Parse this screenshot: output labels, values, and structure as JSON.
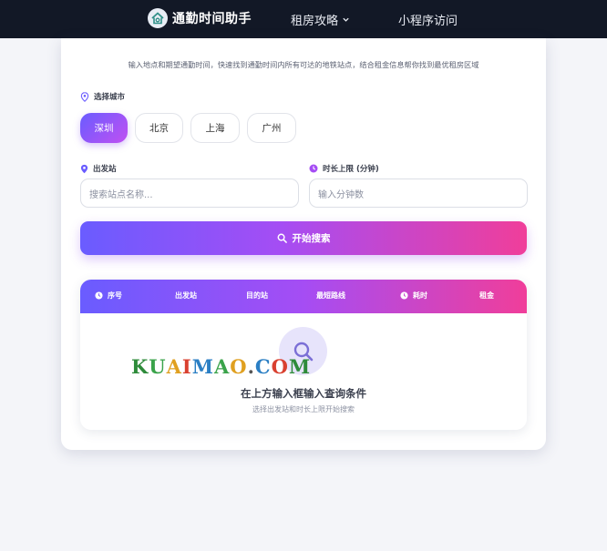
{
  "topbar": {
    "brand": "通勤时间助手",
    "nav": [
      {
        "label": "租房攻略"
      },
      {
        "label": "小程序访问"
      }
    ]
  },
  "intro": "输入地点和期望通勤时间，快速找到通勤时间内所有可达的地铁站点，结合租金信息帮你找到最优租房区域",
  "city": {
    "label": "选择城市",
    "options": [
      "深圳",
      "北京",
      "上海",
      "广州"
    ],
    "selected": "深圳"
  },
  "start": {
    "label": "出发站",
    "placeholder": "搜索站点名称..."
  },
  "duration": {
    "label": "时长上限 (分钟)",
    "placeholder": "输入分钟数"
  },
  "search_button": "开始搜索",
  "table": {
    "headers": [
      "序号",
      "出发站",
      "目的站",
      "最短路线",
      "耗时",
      "租金"
    ]
  },
  "empty": {
    "title": "在上方输入框输入查询条件",
    "subtitle": "选择出发站和时长上限开始搜索"
  },
  "watermark": "KUAIMAO.COM",
  "colors": {
    "topbar": "#121826",
    "accent_start": "#6a5cff",
    "accent_mid": "#a54df4",
    "accent_end": "#f03e9a"
  }
}
